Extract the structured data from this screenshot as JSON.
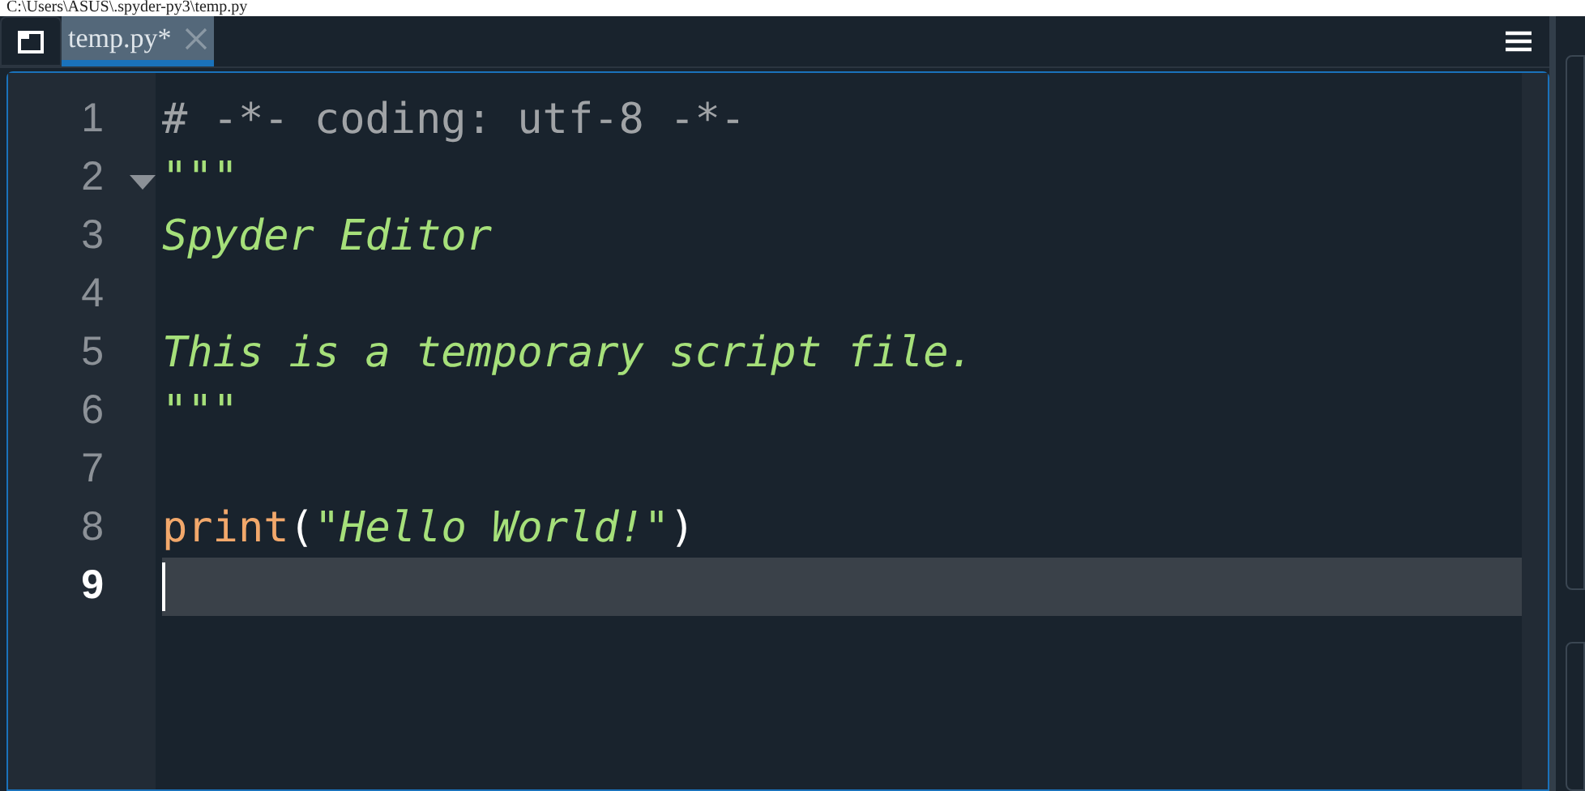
{
  "window": {
    "title": "C:\\Users\\ASUS\\.spyder-py3\\temp.py"
  },
  "tabs": [
    {
      "label": "temp.py*",
      "selected": true
    }
  ],
  "editor": {
    "lines": [
      {
        "number": "1",
        "current": false,
        "foldable": false,
        "tokens": [
          {
            "kind": "comment",
            "text": "# -*- coding: utf-8 -*-"
          }
        ]
      },
      {
        "number": "2",
        "current": false,
        "foldable": true,
        "tokens": [
          {
            "kind": "string",
            "text": "\"\"\""
          }
        ]
      },
      {
        "number": "3",
        "current": false,
        "foldable": false,
        "tokens": [
          {
            "kind": "string",
            "text": "Spyder Editor"
          }
        ]
      },
      {
        "number": "4",
        "current": false,
        "foldable": false
      },
      {
        "number": "5",
        "current": false,
        "foldable": false,
        "tokens": [
          {
            "kind": "string",
            "text": "This is a temporary script file."
          }
        ]
      },
      {
        "number": "6",
        "current": false,
        "foldable": false,
        "tokens": [
          {
            "kind": "string",
            "text": "\"\"\""
          }
        ]
      },
      {
        "number": "7",
        "current": false,
        "foldable": false
      },
      {
        "number": "8",
        "current": false,
        "foldable": false,
        "tokens": [
          {
            "kind": "builtin",
            "text": "print"
          },
          {
            "kind": "plain",
            "text": "("
          },
          {
            "kind": "string",
            "text": "\"Hello World!\""
          },
          {
            "kind": "plain",
            "text": ")"
          }
        ]
      },
      {
        "number": "9",
        "current": true,
        "foldable": false
      }
    ]
  }
}
